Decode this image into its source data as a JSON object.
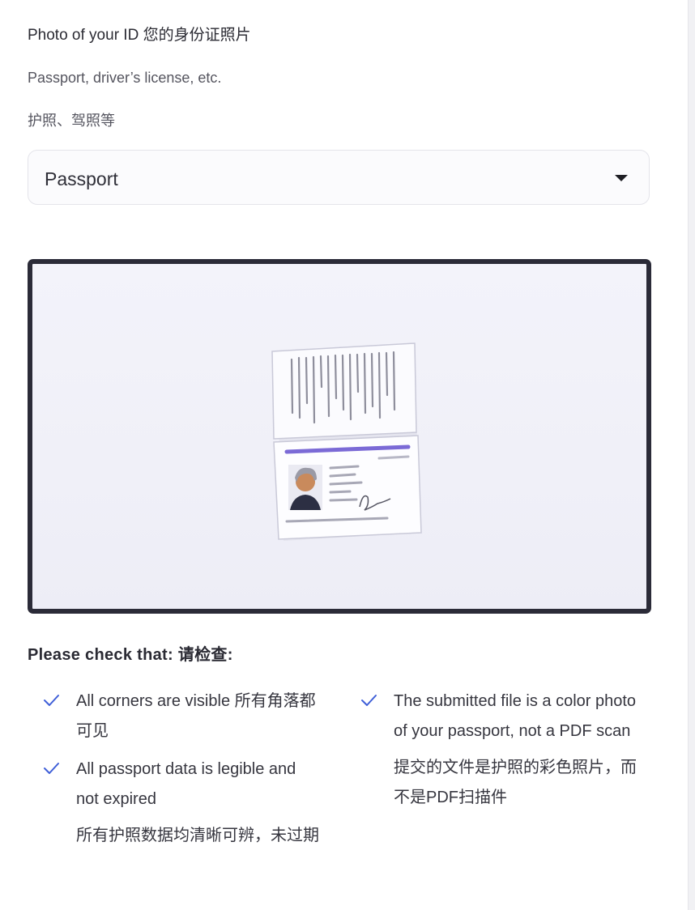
{
  "header": {
    "title": "Photo of your ID 您的身份证照片",
    "hint_en": "Passport, driver’s license, etc.",
    "hint_zh": "护照、驾照等"
  },
  "id_type_select": {
    "value": "Passport"
  },
  "checklist": {
    "title": "Please check that: 请检查:",
    "items": [
      {
        "text": "All corners are visible 所有角落都可见"
      },
      {
        "text": "All passport data is legible and not expired",
        "sub": "所有护照数据均清晰可辨，未过期"
      },
      {
        "text": "The submitted file is a color photo of your passport, not a PDF scan",
        "sub": "提交的文件是护照的彩色照片，而不是PDF扫描件"
      }
    ]
  },
  "colors": {
    "accent": "#3f5fd8",
    "frame": "#2b2b38",
    "passport_stripe": "#7b6ad6"
  },
  "icons": {
    "check": "check-icon",
    "dropdown": "caret-down-icon"
  }
}
